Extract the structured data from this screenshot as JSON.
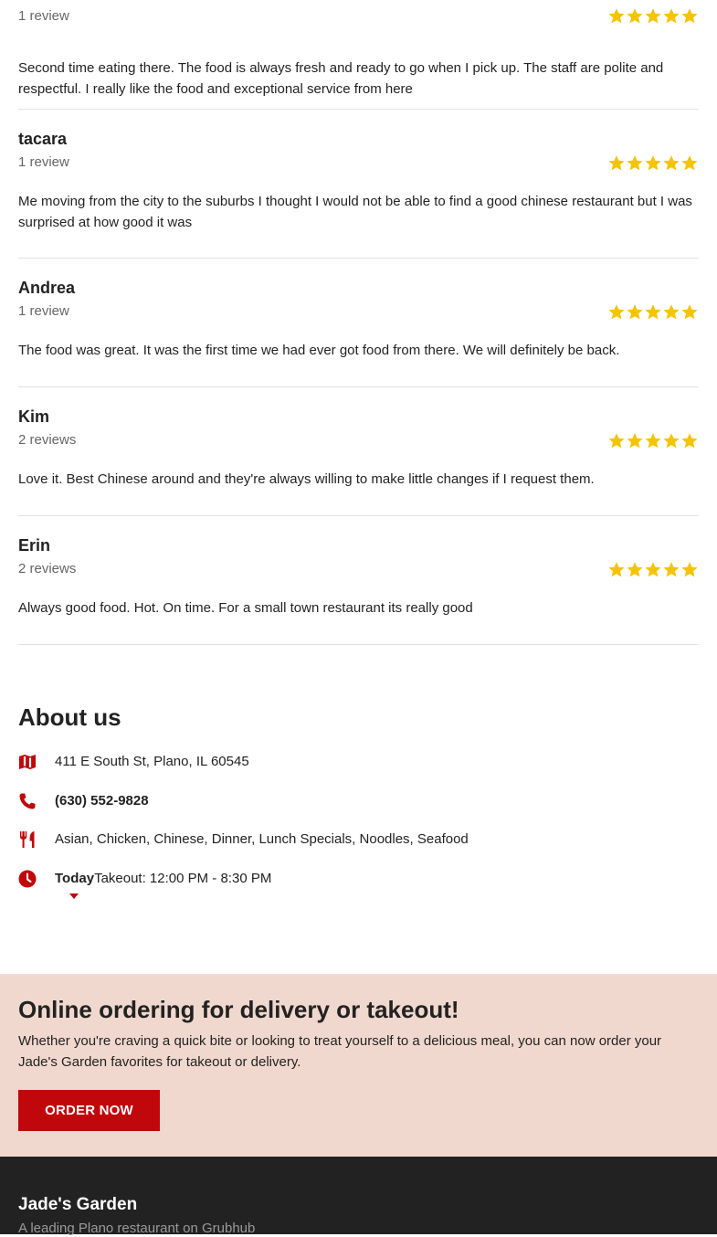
{
  "reviews": [
    {
      "name": "",
      "count": "1 review",
      "rating": 5,
      "text": "Second time eating there. The food is always fresh and ready to go when I pick up. The staff are polite and respectful. I really like the food and exceptional service from here"
    },
    {
      "name": "tacara",
      "count": "1 review",
      "rating": 5,
      "text": "Me moving from the city to the suburbs I thought I would not be able to find a good chinese restaurant but I was surprised at how good it was"
    },
    {
      "name": "Andrea",
      "count": "1 review",
      "rating": 5,
      "text": "The food was great. It was the first time we had ever got food from there. We will definitely be back."
    },
    {
      "name": "Kim",
      "count": "2 reviews",
      "rating": 5,
      "text": "Love it. Best Chinese around and they're always willing to make little changes if I request them."
    },
    {
      "name": "Erin",
      "count": "2 reviews",
      "rating": 5,
      "text": "Always good food. Hot. On time. For a small town restaurant its really good"
    }
  ],
  "about": {
    "title": "About us",
    "address": "411 E South St, Plano, IL 60545",
    "phone": "(630) 552-9828",
    "cuisines": "Asian, Chicken, Chinese, Dinner, Lunch Specials, Noodles, Seafood",
    "hours_day": "Today",
    "hours_text": "Takeout: 12:00 PM - 8:30 PM",
    "icons": {
      "address": "map-icon",
      "phone": "phone-icon",
      "cuisines": "utensils-icon",
      "hours": "clock-icon",
      "expand": "caret-down-icon"
    }
  },
  "promo": {
    "title": "Online ordering for delivery or takeout!",
    "body": "Whether you're craving a quick bite or looking to treat yourself to a delicious meal, you can now order your Jade's Garden favorites for takeout or delivery.",
    "button_label": "ORDER NOW"
  },
  "footer": {
    "name": "Jade's Garden",
    "tagline": "A leading Plano restaurant on Grubhub"
  },
  "colors": {
    "accent": "#c0070b",
    "star": "#f5c400",
    "promo_bg": "#f1d8ce",
    "footer_bg": "#222222"
  }
}
